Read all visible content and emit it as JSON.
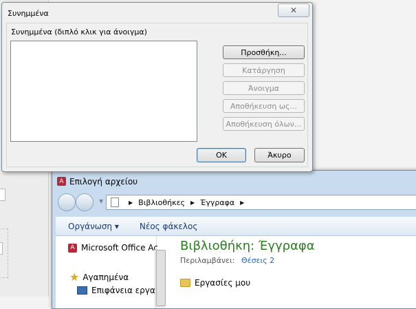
{
  "attachments_dialog": {
    "title": "Συνημμένα",
    "close_glyph": "✕",
    "list_label": "Συνημμένα (διπλό κλικ για άνοιγμα)",
    "buttons": {
      "add": "Προσθήκη...",
      "remove": "Κατάργηση",
      "open": "Άνοιγμα",
      "save_as": "Αποθήκευση ως...",
      "save_all": "Αποθήκευση όλων..."
    },
    "ok": "OK",
    "cancel": "Άκυρο"
  },
  "file_picker": {
    "title": "Επιλογή αρχείου",
    "breadcrumb": [
      "Βιβλιοθήκες",
      "Έγγραφα"
    ],
    "toolbar": {
      "organize": "Οργάνωση ▾",
      "new_folder": "Νέος φάκελος"
    },
    "nav": {
      "office_item": "Microsoft Office Ac",
      "favorites": "Αγαπημένα",
      "desktop": "Επιφάνεια εργασ"
    },
    "library_title": "Βιβλιοθήκη: Έγγραφα",
    "library_includes_label": "Περιλαμβάνει:",
    "library_locations": "Θέσεις 2",
    "file_items": [
      "Εργασίες μου"
    ]
  }
}
